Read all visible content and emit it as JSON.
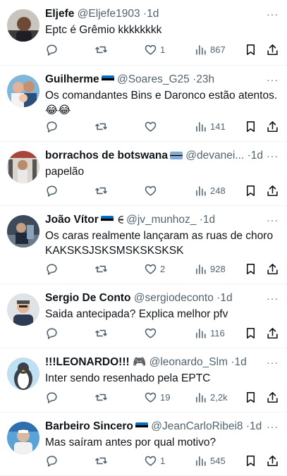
{
  "colors": {
    "text": "#0f1419",
    "muted": "#536471",
    "divider": "#eff3f4"
  },
  "tweets": [
    {
      "name": "Eljefe",
      "handle": "@Eljefe1903",
      "dot": "·",
      "time": "1d",
      "text": "Eptc é Grêmio kkkkkkkk",
      "replies": "",
      "retweets": "",
      "likes": "1",
      "views": "867",
      "more": "···"
    },
    {
      "name": "Guilherme",
      "flag": "estonia-flag",
      "handle": "@Soares_G25",
      "dot": "·",
      "time": "23h",
      "text": "Os comandantes Bins e Daronco estão atentos.",
      "emoji": "😂😂",
      "replies": "",
      "retweets": "",
      "likes": "",
      "views": "141",
      "more": "···"
    },
    {
      "name": "borrachos de botswana",
      "flag": "botswana-flag",
      "handle": "@devanei...",
      "dot": "·",
      "time": "1d",
      "text": "papelão",
      "replies": "",
      "retweets": "",
      "likes": "",
      "views": "248",
      "more": "···"
    },
    {
      "name": "João Vítor",
      "flag": "estonia-flag",
      "handle": "@jv_munhoz_",
      "dot": "·",
      "time": "1d",
      "text": "Os caras realmente lançaram as ruas de choro KAKSKSJSKSMSKSKSKSK",
      "replies": "",
      "retweets": "",
      "likes": "2",
      "views": "928",
      "more": "···"
    },
    {
      "name": "Sergio De Conto",
      "handle": "@sergiodeconto",
      "dot": "·",
      "time": "1d",
      "text": "Saida antecipada? Explica melhor pfv",
      "replies": "",
      "retweets": "",
      "likes": "",
      "views": "116",
      "more": "···"
    },
    {
      "name": "!!!LEONARDO!!!",
      "badge": "🎮",
      "handle": "@leonardo_Slm",
      "dot": "·",
      "time": "1d",
      "text": "Inter sendo resenhado pela EPTC",
      "replies": "",
      "retweets": "",
      "likes": "19",
      "views": "2,2k",
      "more": "···"
    },
    {
      "name": "Barbeiro Sincero",
      "flag": "estonia-flag",
      "handle": "@JeanCarloRibei8",
      "dot": "·",
      "time": "1d",
      "text": "Mas saíram antes por qual motivo?",
      "replies": "",
      "retweets": "",
      "likes": "1",
      "views": "545",
      "more": "···"
    }
  ]
}
